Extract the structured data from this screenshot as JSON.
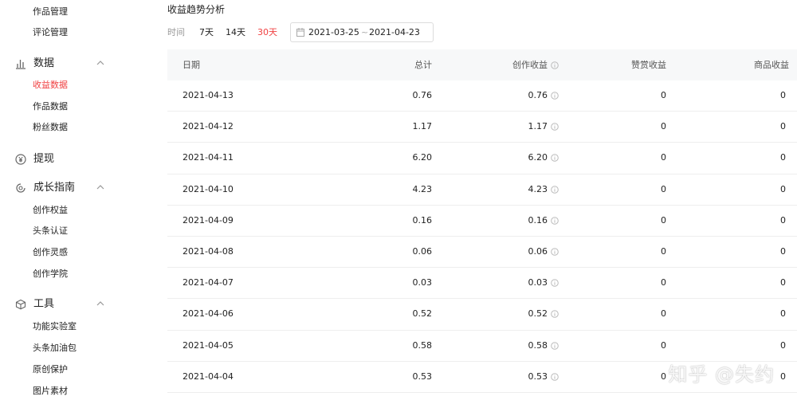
{
  "sidebar": {
    "top_items": [
      {
        "label": "作品管理"
      },
      {
        "label": "评论管理"
      }
    ],
    "data_group": {
      "label": "数据",
      "items": [
        {
          "label": "收益数据",
          "active": true
        },
        {
          "label": "作品数据"
        },
        {
          "label": "粉丝数据"
        }
      ]
    },
    "withdraw": {
      "label": "提现"
    },
    "growth_group": {
      "label": "成长指南",
      "items": [
        {
          "label": "创作权益"
        },
        {
          "label": "头条认证"
        },
        {
          "label": "创作灵感"
        },
        {
          "label": "创作学院"
        }
      ]
    },
    "tools_group": {
      "label": "工具",
      "items": [
        {
          "label": "功能实验室"
        },
        {
          "label": "头条加油包"
        },
        {
          "label": "原创保护"
        },
        {
          "label": "图片素材"
        }
      ]
    }
  },
  "main": {
    "title": "收益趋势分析",
    "filter": {
      "label": "时间",
      "ranges": [
        {
          "label": "7天"
        },
        {
          "label": "14天"
        },
        {
          "label": "30天",
          "active": true
        }
      ],
      "date_start": "2021-03-25",
      "date_sep": "~",
      "date_end": "2021-04-23"
    },
    "table": {
      "headers": {
        "date": "日期",
        "total": "总计",
        "creation": "创作收益",
        "reward": "赞赏收益",
        "goods": "商品收益"
      },
      "rows": [
        {
          "date": "2021-04-13",
          "total": "0.76",
          "creation": "0.76",
          "reward": "0",
          "goods": "0"
        },
        {
          "date": "2021-04-12",
          "total": "1.17",
          "creation": "1.17",
          "reward": "0",
          "goods": "0"
        },
        {
          "date": "2021-04-11",
          "total": "6.20",
          "creation": "6.20",
          "reward": "0",
          "goods": "0"
        },
        {
          "date": "2021-04-10",
          "total": "4.23",
          "creation": "4.23",
          "reward": "0",
          "goods": "0"
        },
        {
          "date": "2021-04-09",
          "total": "0.16",
          "creation": "0.16",
          "reward": "0",
          "goods": "0"
        },
        {
          "date": "2021-04-08",
          "total": "0.06",
          "creation": "0.06",
          "reward": "0",
          "goods": "0"
        },
        {
          "date": "2021-04-07",
          "total": "0.03",
          "creation": "0.03",
          "reward": "0",
          "goods": "0"
        },
        {
          "date": "2021-04-06",
          "total": "0.52",
          "creation": "0.52",
          "reward": "0",
          "goods": "0"
        },
        {
          "date": "2021-04-05",
          "total": "0.58",
          "creation": "0.58",
          "reward": "0",
          "goods": "0"
        },
        {
          "date": "2021-04-04",
          "total": "0.53",
          "creation": "0.53",
          "reward": "0",
          "goods": "0"
        }
      ]
    }
  },
  "watermark": "知乎 @失约",
  "colors": {
    "accent": "#f04142",
    "header_bg": "#f7f8f9",
    "page_bg": "#f4f5f6"
  },
  "icons": {
    "data": "bar-chart-icon",
    "withdraw": "yen-circle-icon",
    "growth": "growth-icon",
    "tools": "cube-icon",
    "chevron": "chevron-up-icon",
    "calendar": "calendar-icon",
    "info": "info-icon"
  }
}
